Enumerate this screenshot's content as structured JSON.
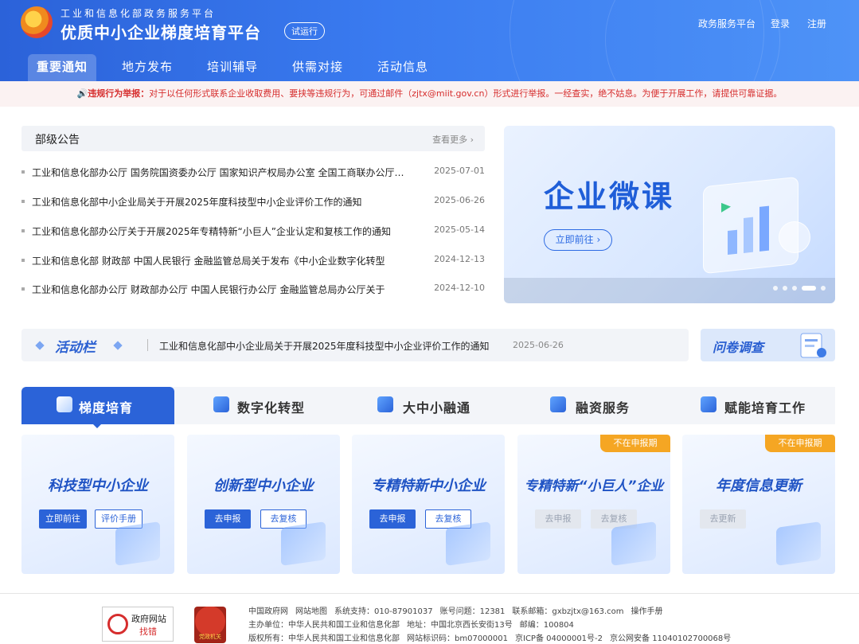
{
  "header": {
    "subtitle": "工业和信息化部政务服务平台",
    "title": "优质中小企业梯度培育平台",
    "beta_badge": "试运行",
    "links": [
      "政务服务平台",
      "登录",
      "注册"
    ]
  },
  "nav": {
    "tabs": [
      "重要通知",
      "地方发布",
      "培训辅导",
      "供需对接",
      "活动信息"
    ],
    "active": "重要通知"
  },
  "notice": {
    "label": "违规行为举报：",
    "text": "对于以任何形式联系企业收取费用、要挟等违规行为，可通过邮件（zjtx@miit.gov.cn）形式进行举报。一经查实，绝不姑息。为便于开展工作，请提供可靠证据。"
  },
  "announcements": {
    "title": "部级公告",
    "more": "查看更多",
    "items": [
      {
        "text": "工业和信息化部办公厅 国务院国资委办公厅 国家知识产权局办公室 全国工商联办公厅关于开展",
        "date": "2025-07-01"
      },
      {
        "text": "工业和信息化部中小企业局关于开展2025年度科技型中小企业评价工作的通知",
        "date": "2025-06-26"
      },
      {
        "text": "工业和信息化部办公厅关于开展2025年专精特新“小巨人”企业认定和复核工作的通知",
        "date": "2025-05-14"
      },
      {
        "text": "工业和信息化部 财政部 中国人民银行 金融监管总局关于发布《中小企业数字化转型",
        "date": "2024-12-13"
      },
      {
        "text": "工业和信息化部办公厅 财政部办公厅 中国人民银行办公厅 金融监管总局办公厅关于",
        "date": "2024-12-10"
      }
    ]
  },
  "banner": {
    "title": "企业微课",
    "button": "立即前往",
    "slide_count": 5,
    "active_slide": 4
  },
  "activity": {
    "label": "活动栏",
    "text": "工业和信息化部中小企业局关于开展2025年度科技型中小企业评价工作的通知",
    "date": "2025-06-26",
    "survey": "问卷调查"
  },
  "categories": {
    "tabs": [
      "梯度培育",
      "数字化转型",
      "大中小融通",
      "融资服务",
      "赋能培育工作"
    ],
    "active": "梯度培育"
  },
  "cards": [
    {
      "title": "科技型中小企业",
      "tag": "",
      "buttons": [
        {
          "label": "立即前往",
          "style": "solid"
        },
        {
          "label": "评价手册",
          "style": "line"
        }
      ]
    },
    {
      "title": "创新型中小企业",
      "tag": "",
      "buttons": [
        {
          "label": "去申报",
          "style": "solid"
        },
        {
          "label": "去复核",
          "style": "line"
        }
      ]
    },
    {
      "title": "专精特新中小企业",
      "tag": "",
      "buttons": [
        {
          "label": "去申报",
          "style": "solid"
        },
        {
          "label": "去复核",
          "style": "line"
        }
      ]
    },
    {
      "title": "专精特新“小巨人”企业",
      "tag": "不在申报期",
      "buttons": [
        {
          "label": "去申报",
          "style": "dis"
        },
        {
          "label": "去复核",
          "style": "dis"
        }
      ]
    },
    {
      "title": "年度信息更新",
      "tag": "不在申报期",
      "buttons": [
        {
          "label": "去更新",
          "style": "dis"
        }
      ]
    }
  ],
  "footer": {
    "gov_badge": [
      "政府网站",
      "找错"
    ],
    "emblem": "党政机关",
    "row1": [
      "中国政府网",
      "网站地图",
      "系统支持：010-87901037",
      "账号问题：12381",
      "联系邮箱：gxbzjtx@163.com",
      "操作手册"
    ],
    "row2": [
      "主办单位：中华人民共和国工业和信息化部",
      "地址：中国北京西长安街13号",
      "邮编：100804"
    ],
    "row3": [
      "版权所有：中华人民共和国工业和信息化部",
      "网站标识码：bm07000001",
      "京ICP备 04000001号-2",
      "京公网安备 11040102700068号"
    ]
  },
  "colors": {
    "primary": "#2b63d8",
    "notice_red": "#d62d2d",
    "tag_orange": "#f5a623"
  }
}
